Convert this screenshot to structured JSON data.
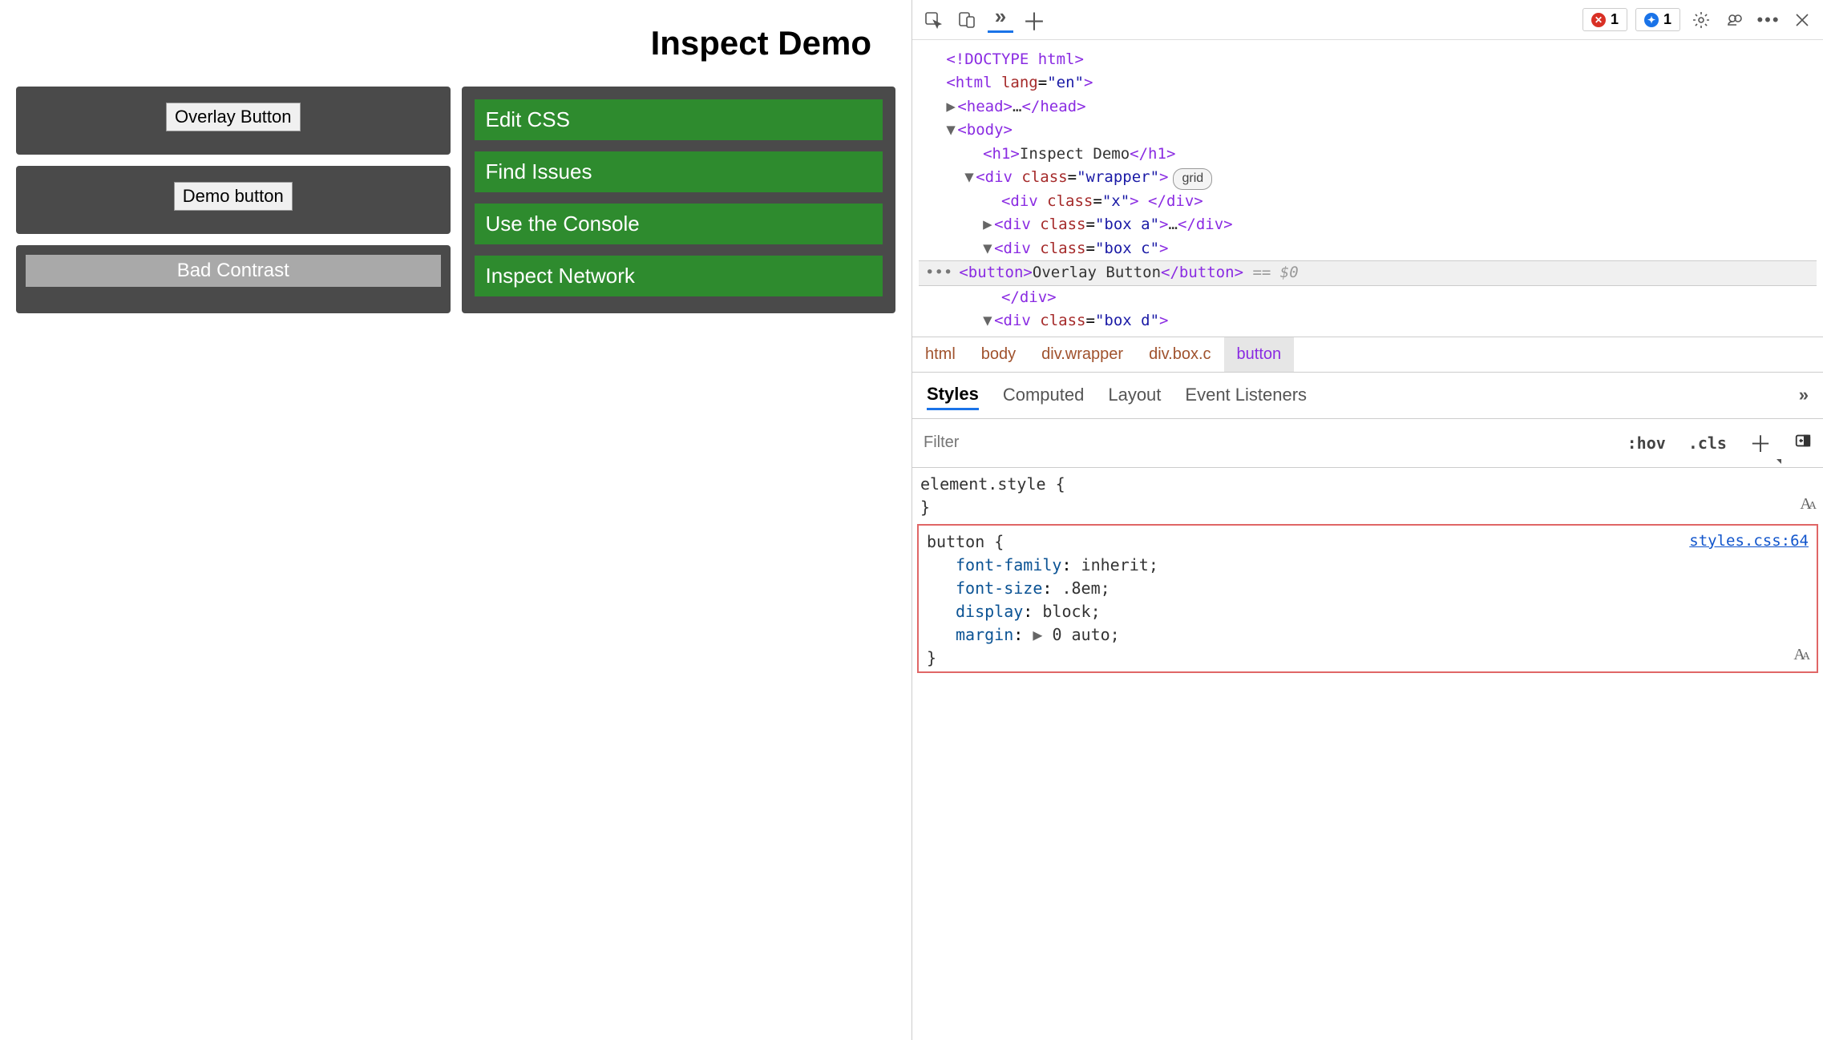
{
  "page": {
    "title": "Inspect Demo",
    "left_buttons": [
      "Overlay Button",
      "Demo button"
    ],
    "bad_contrast_label": "Bad Contrast",
    "green_links": [
      "Edit CSS",
      "Find Issues",
      "Use the Console",
      "Inspect Network"
    ]
  },
  "toolbar": {
    "error_count": "1",
    "info_count": "1"
  },
  "dom": {
    "l0": "<!DOCTYPE html>",
    "l1_open": "<",
    "l1_tag": "html",
    "l1_attr": " lang",
    "l1_eq": "=",
    "l1_val": "\"en\"",
    "l1_close": ">",
    "l2": {
      "open": "<",
      "tag": "head",
      "mid": ">",
      "ell": "…",
      "co": "</",
      "ct": ">"
    },
    "l3": {
      "open": "<",
      "tag": "body",
      "close": ">"
    },
    "l4": {
      "open": "<",
      "tag": "h1",
      "mid": ">",
      "text": "Inspect Demo",
      "co": "</",
      "ct": ">"
    },
    "l5": {
      "open": "<",
      "tag": "div",
      "attr": " class",
      "eq": "=",
      "val": "\"wrapper\"",
      "close": ">",
      "badge": "grid"
    },
    "l6": {
      "open": "<",
      "tag": "div",
      "attr": " class",
      "eq": "=",
      "val": "\"x\"",
      "mid": "> ",
      "co": "</",
      "ctag": "div",
      "ct": ">"
    },
    "l7": {
      "open": "<",
      "tag": "div",
      "attr": " class",
      "eq": "=",
      "val": "\"box a\"",
      "mid": ">",
      "ell": "…",
      "co": "</",
      "ctag": "div",
      "ct": ">"
    },
    "l8": {
      "open": "<",
      "tag": "div",
      "attr": " class",
      "eq": "=",
      "val": "\"box c\"",
      "close": ">"
    },
    "l9": {
      "open": "<",
      "tag": "button",
      "mid": ">",
      "text": "Overlay Button",
      "co": "</",
      "ctag": "button",
      "ct": ">",
      "suffix": " == $0"
    },
    "l10": {
      "co": "</",
      "tag": "div",
      "ct": ">"
    },
    "l11": {
      "open": "<",
      "tag": "div",
      "attr": " class",
      "eq": "=",
      "val": "\"box d\"",
      "close": ">"
    }
  },
  "breadcrumb": [
    "html",
    "body",
    "div.wrapper",
    "div.box.c",
    "button"
  ],
  "styles_tabs": [
    "Styles",
    "Computed",
    "Layout",
    "Event Listeners"
  ],
  "filter": {
    "placeholder": "Filter",
    "hov": ":hov",
    "cls": ".cls"
  },
  "rule1": {
    "selector": "element.style {",
    "close": "}"
  },
  "rule2": {
    "selector": "button {",
    "source": "styles.css:64",
    "decls": [
      {
        "prop": "font-family",
        "val": "inherit;"
      },
      {
        "prop": "font-size",
        "val": ".8em;"
      },
      {
        "prop": "display",
        "val": "block;"
      },
      {
        "prop": "margin",
        "val": "0 auto;",
        "expand": true
      }
    ],
    "close": "}"
  },
  "ellipsis": "…",
  "dots": "•••"
}
